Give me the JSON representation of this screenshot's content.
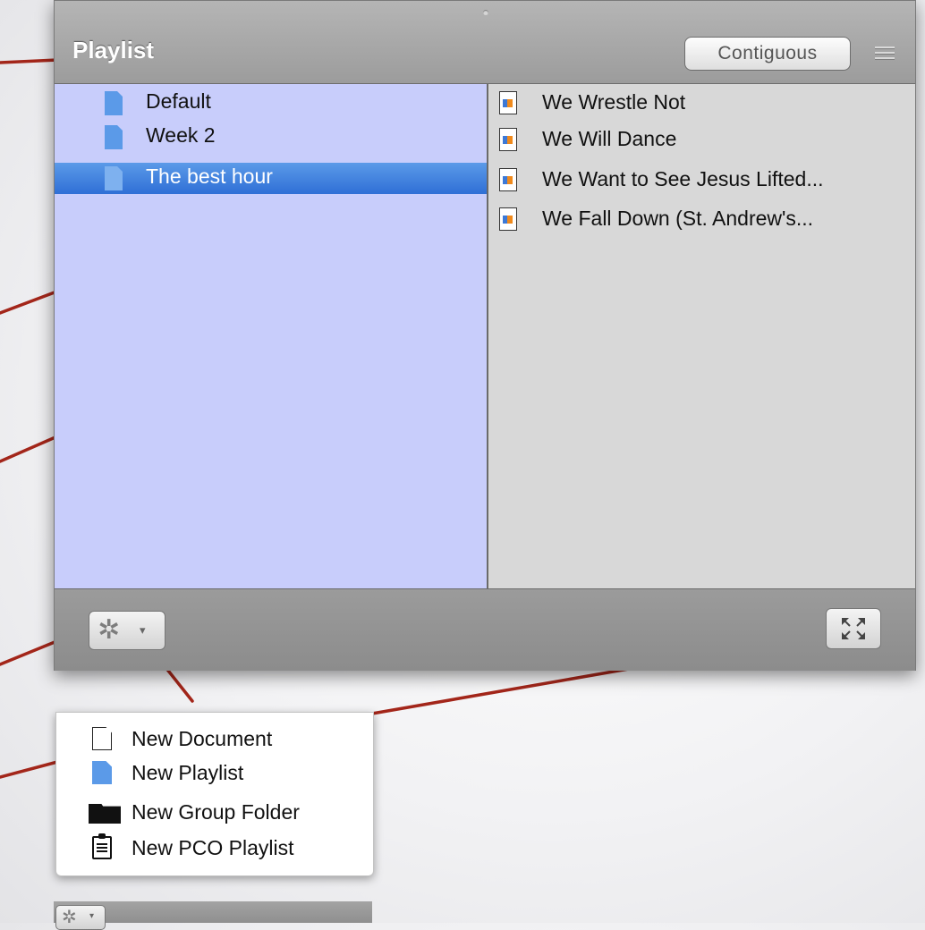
{
  "panel": {
    "title": "Playlist",
    "contiguous_button": "Contiguous",
    "playlists": [
      {
        "label": "Default",
        "selected": false
      },
      {
        "label": "Week 2",
        "selected": false
      },
      {
        "label": "The best hour",
        "selected": true
      }
    ],
    "songs": [
      {
        "label": "We Wrestle Not"
      },
      {
        "label": "We Will Dance"
      },
      {
        "label": "We Want to See Jesus Lifted..."
      },
      {
        "label": "We Fall Down (St. Andrew's..."
      }
    ],
    "footer": {
      "gear_icon": "gear-icon",
      "gear_glyph": "✲",
      "caret_glyph": "▾",
      "expand_icon": "expand-icon"
    }
  },
  "popup_menu": {
    "items": [
      {
        "label": "New Document",
        "icon": "document-icon"
      },
      {
        "label": "New Playlist",
        "icon": "playlist-icon"
      },
      {
        "label": "New Group Folder",
        "icon": "folder-icon"
      },
      {
        "label": "New PCO Playlist",
        "icon": "clipboard-icon"
      }
    ]
  },
  "colors": {
    "callout_line": "#a3261a",
    "selection": "#3b7ddd",
    "left_pane_bg": "#c8cdfb"
  }
}
